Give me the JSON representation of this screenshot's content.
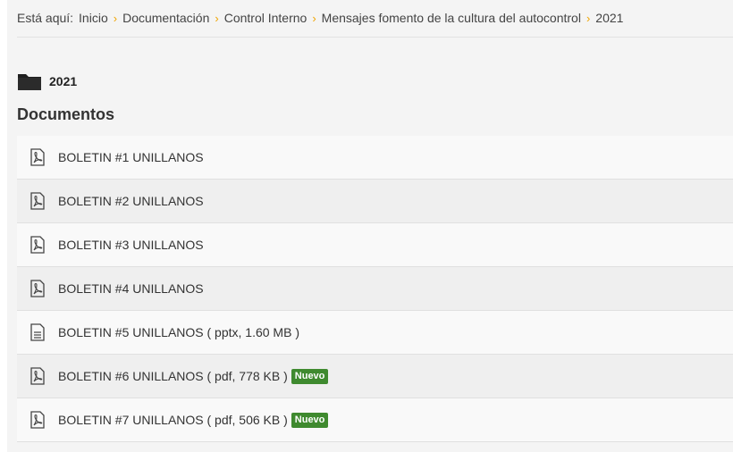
{
  "breadcrumb": {
    "prefix": "Está aquí:",
    "items": [
      "Inicio",
      "Documentación",
      "Control Interno",
      "Mensajes fomento de la cultura del autocontrol",
      "2021"
    ]
  },
  "folder": {
    "name": "2021"
  },
  "section_title": "Documentos",
  "documents": [
    {
      "label": "BOLETIN #1 UNILLANOS",
      "icon": "pdf-icon"
    },
    {
      "label": "BOLETIN #2 UNILLANOS",
      "icon": "pdf-icon"
    },
    {
      "label": "BOLETIN #3 UNILLANOS",
      "icon": "pdf-icon"
    },
    {
      "label": "BOLETIN #4 UNILLANOS",
      "icon": "pdf-icon"
    },
    {
      "label": "BOLETIN #5 UNILLANOS ( pptx, 1.60 MB )",
      "icon": "document-icon"
    },
    {
      "label": "BOLETIN #6 UNILLANOS ( pdf, 778 KB )",
      "icon": "pdf-icon",
      "badge": "Nuevo"
    },
    {
      "label": "BOLETIN #7 UNILLANOS ( pdf, 506 KB )",
      "icon": "pdf-icon",
      "badge": "Nuevo"
    }
  ],
  "colors": {
    "separator": "#f0a500",
    "badge": "#3f8a2f"
  }
}
